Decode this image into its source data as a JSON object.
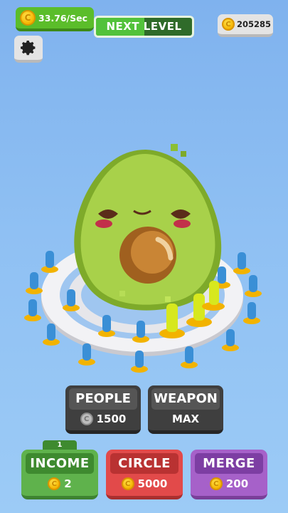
{
  "hud": {
    "income_rate": "33.76/Sec",
    "next_level_label": "NEXT LEVEL",
    "next_level_progress": 0.5,
    "total_coins": "205285"
  },
  "icons": {
    "coin": "coin-icon",
    "settings": "gear-icon"
  },
  "upgrades": {
    "people": {
      "label": "PEOPLE",
      "cost": "1500"
    },
    "weapon": {
      "label": "WEAPON",
      "cost": "MAX"
    },
    "income": {
      "label": "INCOME",
      "cost": "2",
      "level": "1"
    },
    "circle": {
      "label": "CIRCLE",
      "cost": "5000"
    },
    "merge": {
      "label": "MERGE",
      "cost": "200"
    }
  },
  "colors": {
    "income": "#5fb24c",
    "circle": "#e24a4a",
    "merge": "#a661c9",
    "avocado": "#9ccc3c",
    "sky": "#8fc0f3"
  }
}
